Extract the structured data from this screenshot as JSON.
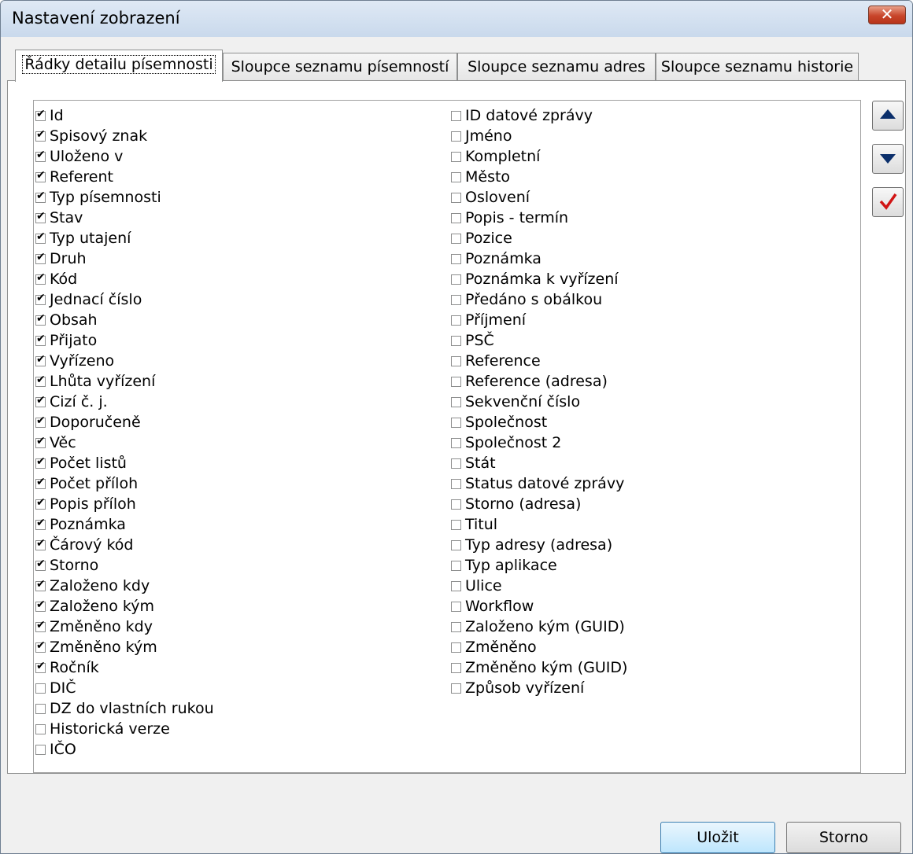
{
  "window": {
    "title": "Nastavení zobrazení"
  },
  "tabs": [
    "Řádky detailu písemnosti",
    "Sloupce seznamu písemností",
    "Sloupce seznamu adres",
    "Sloupce seznamu historie"
  ],
  "list": {
    "left": [
      {
        "label": "Id",
        "checked": true
      },
      {
        "label": "Spisový znak",
        "checked": true
      },
      {
        "label": "Uloženo v",
        "checked": true
      },
      {
        "label": "Referent",
        "checked": true
      },
      {
        "label": "Typ písemnosti",
        "checked": true
      },
      {
        "label": "Stav",
        "checked": true
      },
      {
        "label": "Typ utajení",
        "checked": true
      },
      {
        "label": "Druh",
        "checked": true
      },
      {
        "label": "Kód",
        "checked": true
      },
      {
        "label": "Jednací číslo",
        "checked": true
      },
      {
        "label": "Obsah",
        "checked": true
      },
      {
        "label": "Přijato",
        "checked": true
      },
      {
        "label": "Vyřízeno",
        "checked": true
      },
      {
        "label": "Lhůta vyřízení",
        "checked": true
      },
      {
        "label": "Cizí č. j.",
        "checked": true
      },
      {
        "label": "Doporučeně",
        "checked": true
      },
      {
        "label": "Věc",
        "checked": true
      },
      {
        "label": "Počet listů",
        "checked": true
      },
      {
        "label": "Počet příloh",
        "checked": true
      },
      {
        "label": "Popis příloh",
        "checked": true
      },
      {
        "label": "Poznámka",
        "checked": true
      },
      {
        "label": "Čárový kód",
        "checked": true
      },
      {
        "label": "Storno",
        "checked": true
      },
      {
        "label": "Založeno kdy",
        "checked": true
      },
      {
        "label": "Založeno kým",
        "checked": true
      },
      {
        "label": "Změněno kdy",
        "checked": true
      },
      {
        "label": "Změněno kým",
        "checked": true
      },
      {
        "label": "Ročník",
        "checked": true
      },
      {
        "label": "DIČ",
        "checked": false
      },
      {
        "label": "DZ do vlastních rukou",
        "checked": false
      },
      {
        "label": "Historická verze",
        "checked": false
      },
      {
        "label": "IČO",
        "checked": false
      }
    ],
    "right": [
      {
        "label": "ID datové zprávy",
        "checked": false
      },
      {
        "label": "Jméno",
        "checked": false
      },
      {
        "label": "Kompletní",
        "checked": false
      },
      {
        "label": "Město",
        "checked": false
      },
      {
        "label": "Oslovení",
        "checked": false
      },
      {
        "label": "Popis - termín",
        "checked": false
      },
      {
        "label": "Pozice",
        "checked": false
      },
      {
        "label": "Poznámka",
        "checked": false
      },
      {
        "label": "Poznámka k vyřízení",
        "checked": false
      },
      {
        "label": "Předáno s obálkou",
        "checked": false
      },
      {
        "label": "Příjmení",
        "checked": false
      },
      {
        "label": "PSČ",
        "checked": false
      },
      {
        "label": "Reference",
        "checked": false
      },
      {
        "label": "Reference (adresa)",
        "checked": false
      },
      {
        "label": "Sekvenční číslo",
        "checked": false
      },
      {
        "label": "Společnost",
        "checked": false
      },
      {
        "label": "Společnost 2",
        "checked": false
      },
      {
        "label": "Stát",
        "checked": false
      },
      {
        "label": "Status datové zprávy",
        "checked": false
      },
      {
        "label": "Storno (adresa)",
        "checked": false
      },
      {
        "label": "Titul",
        "checked": false
      },
      {
        "label": "Typ adresy (adresa)",
        "checked": false
      },
      {
        "label": "Typ aplikace",
        "checked": false
      },
      {
        "label": "Ulice",
        "checked": false
      },
      {
        "label": "Workflow",
        "checked": false
      },
      {
        "label": "Založeno kým (GUID)",
        "checked": false
      },
      {
        "label": "Změněno",
        "checked": false
      },
      {
        "label": "Změněno kým (GUID)",
        "checked": false
      },
      {
        "label": "Způsob vyřízení",
        "checked": false
      }
    ]
  },
  "buttons": {
    "save": "Uložit",
    "cancel": "Storno"
  },
  "colors": {
    "arrow": "#0b2f6b",
    "check": "#d11414",
    "default_button": "#bee6fd",
    "close": "#c8452a"
  }
}
